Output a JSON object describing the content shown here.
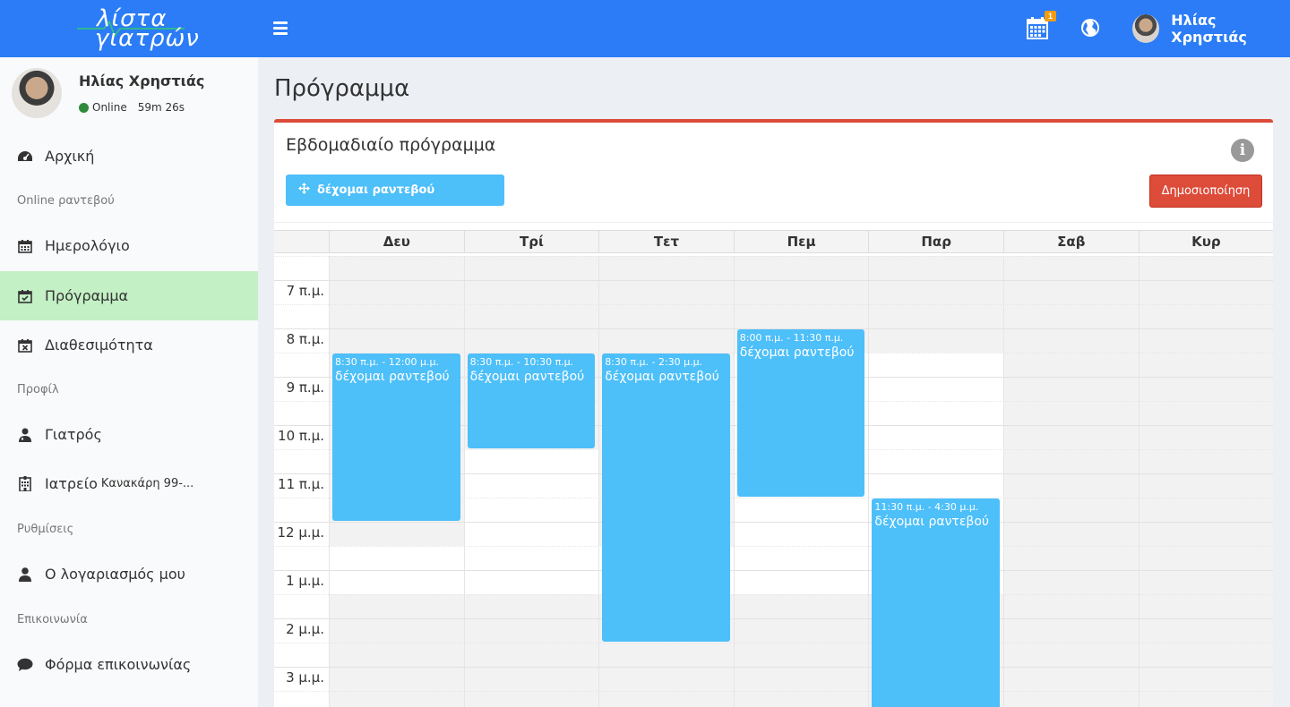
{
  "app": {
    "logo_line1": "λίστα",
    "logo_line2": "γιατρών",
    "notification_count": "1",
    "user_name": "Ηλίας Χρηστιάς"
  },
  "sidebar": {
    "user_name": "Ηλίας Χρηστιάς",
    "status": "Online",
    "session_time": "59m 26s",
    "items": [
      {
        "label": "Αρχική",
        "icon": "dashboard-icon"
      },
      {
        "header": "Online ραντεβού"
      },
      {
        "label": "Ημερολόγιο",
        "icon": "calendar-icon"
      },
      {
        "label": "Πρόγραμμα",
        "icon": "calendar-check-icon",
        "active": true
      },
      {
        "label": "Διαθεσιμότητα",
        "icon": "calendar-x-icon"
      },
      {
        "header": "Προφίλ"
      },
      {
        "label": "Γιατρός",
        "icon": "doctor-icon"
      },
      {
        "label": "Ιατρείο",
        "sub": "Κανακάρη 99-...",
        "icon": "hospital-icon"
      },
      {
        "header": "Ρυθμίσεις"
      },
      {
        "label": "Ο λογαριασμός μου",
        "icon": "user-icon"
      },
      {
        "header": "Επικοινωνία"
      },
      {
        "label": "Φόρμα επικοινωνίας",
        "icon": "chat-icon"
      }
    ]
  },
  "page": {
    "title": "Πρόγραμμα",
    "box_title": "Εβδομαδιαίο πρόγραμμα",
    "drag_button": "δέχομαι ραντεβού",
    "publish_button": "Δημοσιοποίηση",
    "accent_color": "#4dbff9",
    "danger_color": "#dd4b39"
  },
  "calendar": {
    "days": [
      "Δευ",
      "Τρί",
      "Τετ",
      "Πεμ",
      "Παρ",
      "Σαβ",
      "Κυρ"
    ],
    "time_labels": [
      "7 π.μ.",
      "8 π.μ.",
      "9 π.μ.",
      "10 π.μ.",
      "11 π.μ.",
      "12 μ.μ.",
      "1 μ.μ.",
      "2 μ.μ.",
      "3 μ.μ."
    ],
    "events": [
      {
        "day": 0,
        "start": 8.5,
        "end": 12.0,
        "time": "8:30 π.μ. - 12:00 μ.μ.",
        "title": "δέχομαι ραντεβού"
      },
      {
        "day": 1,
        "start": 8.5,
        "end": 10.5,
        "time": "8:30 π.μ. - 10:30 π.μ.",
        "title": "δέχομαι ραντεβού"
      },
      {
        "day": 2,
        "start": 8.5,
        "end": 14.5,
        "time": "8:30 π.μ. - 2:30 μ.μ.",
        "title": "δέχομαι ραντεβού"
      },
      {
        "day": 3,
        "start": 8.0,
        "end": 11.5,
        "time": "8:00 π.μ. - 11:30 π.μ.",
        "title": "δέχομαι ραντεβού"
      },
      {
        "day": 4,
        "start": 11.5,
        "end": 16.5,
        "time": "11:30 π.μ. - 4:30 μ.μ.",
        "title": "δέχομαι ραντεβού"
      }
    ]
  }
}
